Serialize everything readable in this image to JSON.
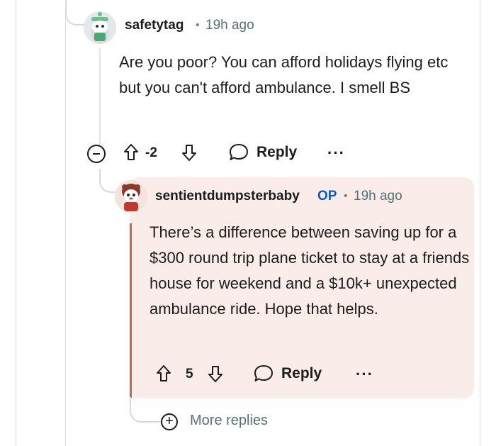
{
  "comments": [
    {
      "username": "safetytag",
      "separator": "•",
      "time": "19h ago",
      "body": "Are you poor? You can afford holidays flying etc but you can't afford ambulance. I smell BS",
      "votes": "-2",
      "reply_label": "Reply",
      "more_label": "···"
    },
    {
      "username": "sentientdumpsterbaby",
      "badge": "OP",
      "separator": "•",
      "time": "19h ago",
      "body": "There’s a difference between saving up for a $300 round trip plane ticket to stay at a friends house for weekend and a $10k+ unexpected ambulance ride. Hope that helps.",
      "votes": "5",
      "reply_label": "Reply",
      "more_label": "···"
    }
  ],
  "more_replies": {
    "icon": "+",
    "label": "More replies"
  },
  "colors": {
    "highlight_bg": "#faece9",
    "op_badge": "#0a58ca",
    "meta": "#576f76"
  }
}
